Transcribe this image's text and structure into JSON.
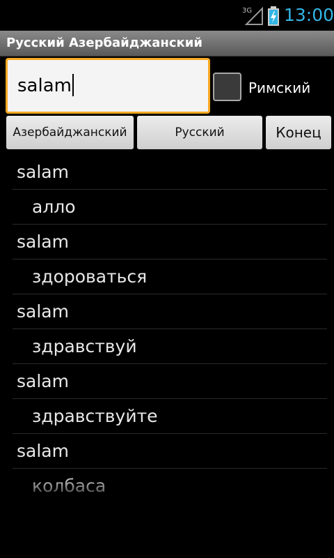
{
  "status_bar": {
    "network": "3G",
    "time": "13:00",
    "icons": [
      "signal-icon",
      "battery-charging-icon"
    ],
    "clock_color": "#33b5e5"
  },
  "app": {
    "title": "Русский Азербайджанский"
  },
  "search": {
    "value": "salam",
    "focus_color": "#f7a823"
  },
  "romanized": {
    "label": "Римский",
    "checked": false
  },
  "buttons": {
    "azerbaijani": "Азербайджанский",
    "russian": "Русский",
    "end": "Конец"
  },
  "results": [
    {
      "word": "salam",
      "translation": "алло"
    },
    {
      "word": "salam",
      "translation": "здороваться"
    },
    {
      "word": "salam",
      "translation": "здравствуй"
    },
    {
      "word": "salam",
      "translation": "здравствуйте"
    },
    {
      "word": "salam",
      "translation": "колбаса"
    }
  ]
}
